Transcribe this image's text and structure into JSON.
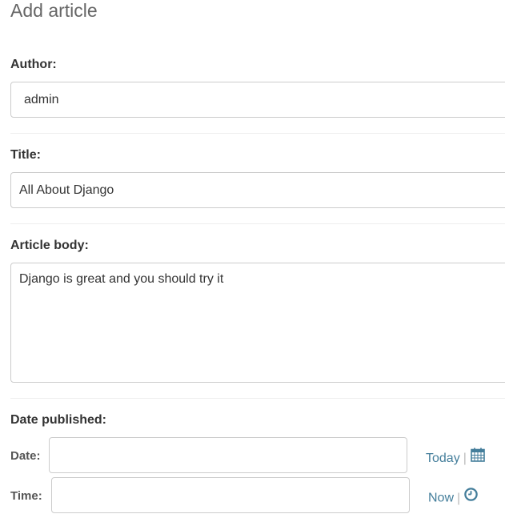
{
  "page": {
    "title": "Add article"
  },
  "author": {
    "label": "Author:",
    "value": "admin"
  },
  "title_field": {
    "label": "Title:",
    "value": "All About Django"
  },
  "body_field": {
    "label": "Article body:",
    "value": "Django is great and you should try it"
  },
  "date_published": {
    "label": "Date published:",
    "date": {
      "label": "Date:",
      "value": "",
      "shortcut_label": "Today",
      "separator": "|",
      "icon": "calendar-icon"
    },
    "time": {
      "label": "Time:",
      "value": "",
      "shortcut_label": "Now",
      "separator": "|",
      "icon": "clock-icon"
    }
  },
  "colors": {
    "link": "#447e9b",
    "border": "#cccccc",
    "divider": "#eeeeee",
    "title": "#666666"
  }
}
